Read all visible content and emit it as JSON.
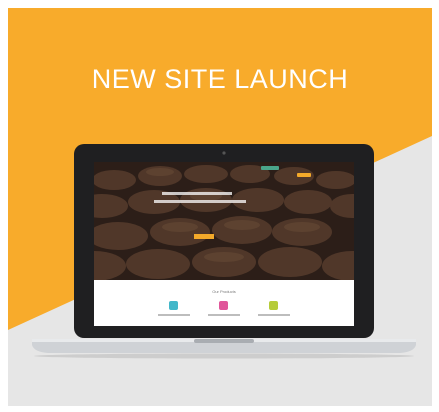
{
  "banner": {
    "headline": "NEW SITE LAUNCH"
  },
  "colors": {
    "accent_orange": "#F8AB2B",
    "background_gray": "#E6E6E6",
    "feature_teal": "#42B7C9",
    "feature_pink": "#E0569A",
    "feature_lime": "#B6CC3A"
  },
  "laptop_screen": {
    "section_title": "Our Products"
  }
}
